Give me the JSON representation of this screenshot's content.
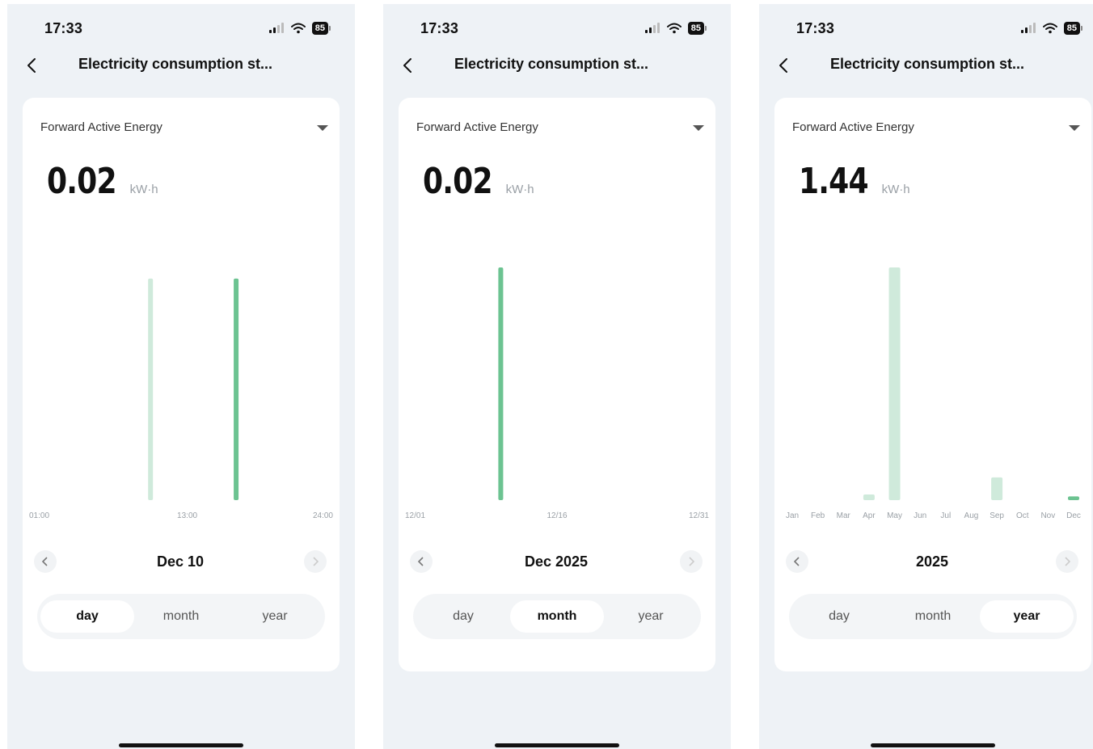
{
  "screens": [
    {
      "status": {
        "time": "17:33",
        "battery": "85"
      },
      "title": "Electricity consumption st...",
      "metric_select": "Forward Active Energy",
      "value": "0.02",
      "unit": "kW·h",
      "period_label": "Dec 10",
      "segments": [
        "day",
        "month",
        "year"
      ],
      "active_segment": 0,
      "chart_data": {
        "type": "bar",
        "x_tick_labels": [
          "01:00",
          "13:00",
          "24:00"
        ],
        "x_ticks_index": [
          0,
          12,
          23
        ],
        "bar_count": 24,
        "values": [
          0,
          0,
          0,
          0,
          0,
          0,
          0,
          0,
          0,
          0.01,
          0,
          0,
          0,
          0,
          0,
          0,
          0.01,
          0,
          0,
          0,
          0,
          0,
          0,
          0
        ],
        "highlight_index": 16,
        "ylim": [
          0,
          0.0105
        ],
        "color": "#6cc391",
        "faded_color": "#cfeadb"
      }
    },
    {
      "status": {
        "time": "17:33",
        "battery": "85"
      },
      "title": "Electricity consumption st...",
      "metric_select": "Forward Active Energy",
      "value": "0.02",
      "unit": "kW·h",
      "period_label": "Dec 2025",
      "segments": [
        "day",
        "month",
        "year"
      ],
      "active_segment": 1,
      "chart_data": {
        "type": "bar",
        "x_tick_labels": [
          "12/01",
          "12/16",
          "12/31"
        ],
        "x_ticks_index": [
          0,
          15,
          30
        ],
        "bar_count": 31,
        "values": [
          0,
          0,
          0,
          0,
          0,
          0,
          0,
          0,
          0,
          0.02,
          0,
          0,
          0,
          0,
          0,
          0,
          0,
          0,
          0,
          0,
          0,
          0,
          0,
          0,
          0,
          0,
          0,
          0,
          0,
          0,
          0
        ],
        "highlight_index": 9,
        "ylim": [
          0,
          0.02
        ],
        "color": "#6cc391",
        "faded_color": "#cfeadb"
      }
    },
    {
      "status": {
        "time": "17:33",
        "battery": "85"
      },
      "title": "Electricity consumption st...",
      "metric_select": "Forward Active Energy",
      "value": "1.44",
      "unit": "kW·h",
      "period_label": "2025",
      "segments": [
        "day",
        "month",
        "year"
      ],
      "active_segment": 2,
      "chart_data": {
        "type": "bar",
        "x_tick_labels": [
          "Jan",
          "Feb",
          "Mar",
          "Apr",
          "May",
          "Jun",
          "Jul",
          "Aug",
          "Sep",
          "Oct",
          "Nov",
          "Dec"
        ],
        "x_ticks_index": [
          0,
          1,
          2,
          3,
          4,
          5,
          6,
          7,
          8,
          9,
          10,
          11
        ],
        "bar_count": 12,
        "values": [
          0,
          0,
          0,
          0.03,
          1.23,
          0,
          0,
          0,
          0.12,
          0,
          0,
          0.02
        ],
        "highlight_index": 11,
        "ylim": [
          0,
          1.23
        ],
        "color": "#6cc391",
        "faded_color": "#cfeadb"
      }
    }
  ]
}
